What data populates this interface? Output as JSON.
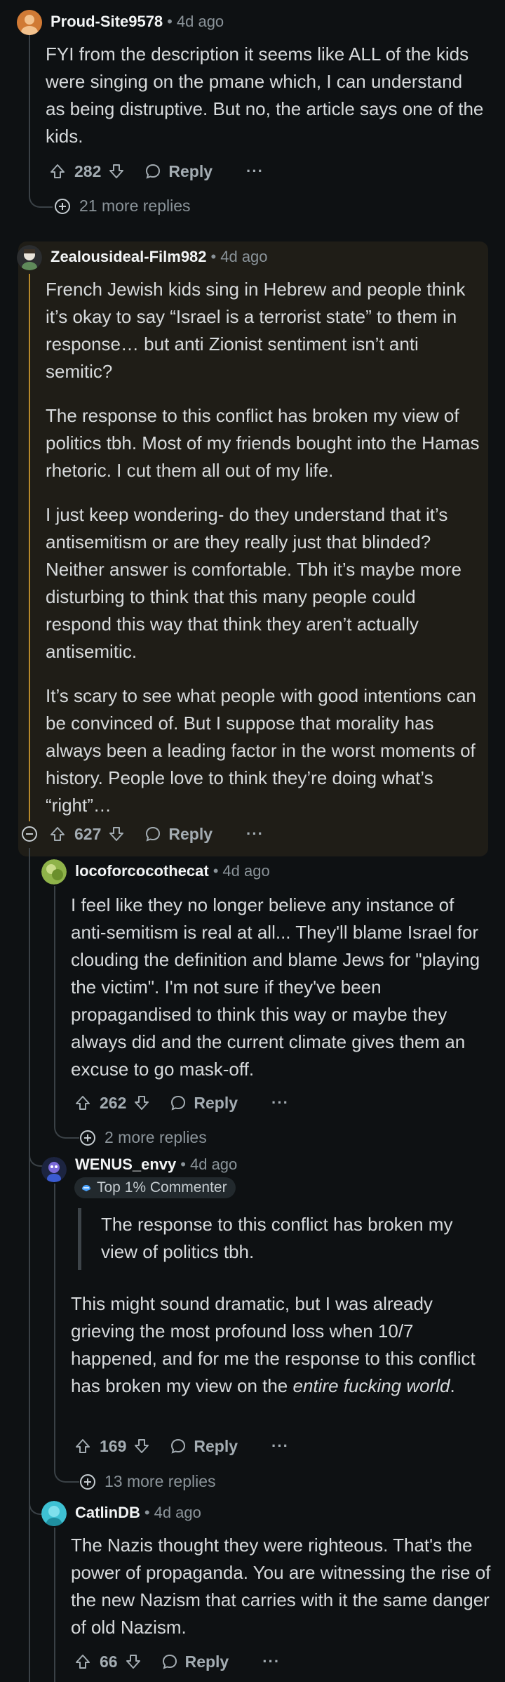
{
  "comments": [
    {
      "user": "Proud-Site9578",
      "time": "4d ago",
      "paragraphs": [
        "FYI from the description it seems like ALL of the kids were singing on the pmane which, I can understand as being distruptive. But no, the article says one of the kids."
      ],
      "votes": "282",
      "reply_label": "Reply",
      "more_label": "···",
      "more_replies": "21 more replies"
    },
    {
      "user": "Zealousideal-Film982",
      "time": "4d ago",
      "paragraphs": [
        "French Jewish kids sing in Hebrew and people think it’s okay to say “Israel is a terrorist state” to them in response… but anti Zionist sentiment isn’t anti semitic?",
        "The response to this conflict has broken my view of politics tbh. Most of my friends bought into the Hamas rhetoric. I cut them all out of my life.",
        "I just keep wondering- do they understand that it’s antisemitism or are they really just that blinded? Neither answer is comfortable. Tbh it’s maybe more disturbing to think that this many people could respond this way that think they aren’t actually antisemitic.",
        "It’s scary to see what people with good intentions can be convinced of. But I suppose that morality has always been a leading factor in the worst moments of history. People love to think they’re doing what’s “right”…"
      ],
      "votes": "627",
      "reply_label": "Reply",
      "more_label": "···"
    },
    {
      "user": "locoforcocothecat",
      "time": "4d ago",
      "paragraphs": [
        "I feel like they no longer believe any instance of anti-semitism is real at all... They'll blame Israel for clouding the definition and blame Jews for \"playing the victim\". I'm not sure if they've been propagandised to think this way or maybe they always did and the current climate gives them an excuse to go mask-off."
      ],
      "votes": "262",
      "reply_label": "Reply",
      "more_label": "···",
      "more_replies": "2 more replies"
    },
    {
      "user": "WENUS_envy",
      "time": "4d ago",
      "badge": "Top 1% Commenter",
      "quote": "The response to this conflict has broken my view of politics tbh.",
      "body_plain": "This might sound dramatic, but I was already grieving the most profound loss when 10/7 happened, and for me the response to this conflict has broken my view on the ",
      "body_emphasis": "entire fucking world",
      "body_end": ".",
      "votes": "169",
      "reply_label": "Reply",
      "more_label": "···",
      "more_replies": "13 more replies"
    },
    {
      "user": "CatlinDB",
      "time": "4d ago",
      "paragraphs": [
        "The Nazis thought they were righteous. That's the power of propaganda. You are witnessing the rise of the new Nazism that carries with it the same danger of old Nazism."
      ],
      "votes": "66",
      "reply_label": "Reply",
      "more_label": "···"
    }
  ],
  "colors": {
    "background": "#0e1113",
    "highlight_card": "#1f1d17",
    "highlight_thread": "#b7892a",
    "thread": "#3a4146",
    "text": "#d7dadc",
    "muted": "#8a9399"
  }
}
